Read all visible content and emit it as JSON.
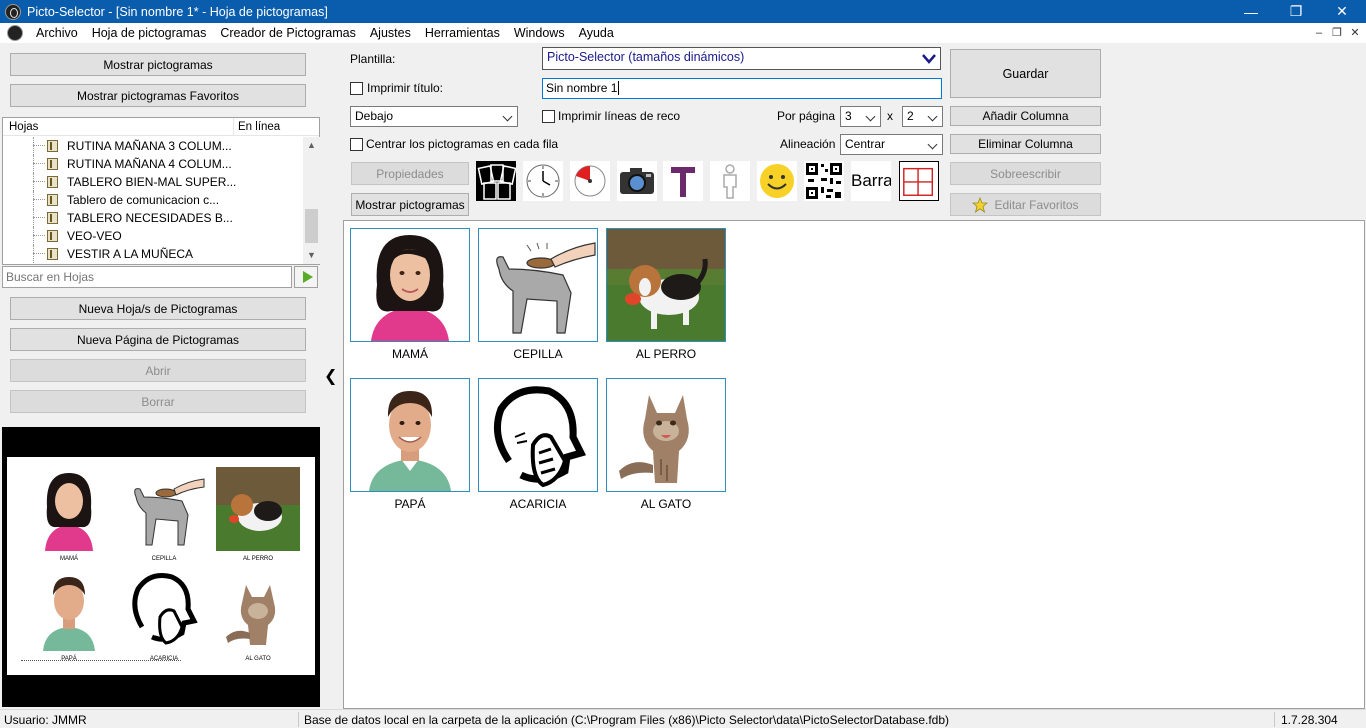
{
  "window": {
    "title": "Picto-Selector - [Sin nombre 1* - Hoja de pictogramas]",
    "minimize": "—",
    "restore": "❐",
    "close": "✕"
  },
  "menu": {
    "items": [
      "Archivo",
      "Hoja de pictogramas",
      "Creador de Pictogramas",
      "Ajustes",
      "Herramientas",
      "Windows",
      "Ayuda"
    ],
    "mdi_min": "–",
    "mdi_restore": "❐",
    "mdi_close": "✕"
  },
  "left": {
    "show_pictos": "Mostrar pictogramas",
    "show_favs": "Mostrar pictogramas Favoritos",
    "tree_col_sheets": "Hojas",
    "tree_col_online": "En línea",
    "tree_items": [
      "RUTINA MAÑANA 3 COLUM...",
      "RUTINA MAÑANA 4 COLUM...",
      "TABLERO BIEN-MAL SUPER...",
      "Tablero de comunicacion c...",
      "TABLERO NECESIDADES B...",
      "VEO-VEO",
      "VESTIR A LA MUÑECA"
    ],
    "search_placeholder": "Buscar en Hojas",
    "new_sheet": "Nueva Hoja/s de Pictogramas",
    "new_page": "Nueva Página de Pictogramas",
    "open": "Abrir",
    "delete": "Borrar",
    "preview_captions": [
      "MAMÁ",
      "CEPILLA",
      "AL PERRO",
      "PAPÁ",
      "ACARICIA",
      "AL GATO"
    ]
  },
  "form": {
    "template_label": "Plantilla:",
    "template_value": "Picto-Selector (tamaños dinámicos)",
    "print_title_label": "Imprimir título:",
    "title_value": "Sin nombre 1",
    "position_value": "Debajo",
    "print_lines_label": "Imprimir líneas de reco",
    "per_page_label": "Por página",
    "per_page_cols": "3",
    "per_page_x": "x",
    "per_page_rows": "2",
    "center_label": "Centrar los pictogramas en cada fila",
    "align_label": "Alineación",
    "align_value": "Centrar",
    "properties": "Propiedades",
    "show_pictos": "Mostrar pictogramas",
    "bar_text": "Barra",
    "save": "Guardar",
    "add_column": "Añadir Columna",
    "remove_column": "Eliminar Columna",
    "overwrite": "Sobreescribir",
    "edit_favs": "Editar Favoritos"
  },
  "pictograms": [
    {
      "label": "MAMÁ"
    },
    {
      "label": "CEPILLA"
    },
    {
      "label": "AL PERRO"
    },
    {
      "label": "PAPÁ"
    },
    {
      "label": "ACARICIA"
    },
    {
      "label": "AL GATO"
    }
  ],
  "status": {
    "user": "Usuario: JMMR",
    "db": "Base de datos local en la carpeta de la aplicación (C:\\Program Files (x86)\\Picto Selector\\data\\PictoSelectorDatabase.fdb)",
    "version": "1.7.28.304"
  },
  "colors": {
    "titlebar": "#0a5dad",
    "picto_border": "#2e8fbf"
  }
}
